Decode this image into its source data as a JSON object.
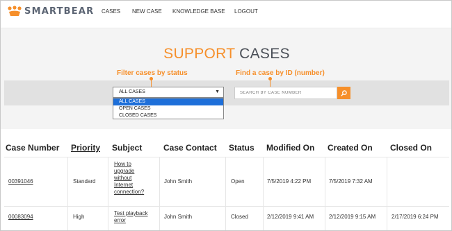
{
  "brand": {
    "name": "SMARTBEAR",
    "logo_icon": "smartbear-paw-logo"
  },
  "nav": {
    "items": [
      "CASES",
      "NEW CASE",
      "KNOWLEDGE BASE",
      "LOGOUT"
    ]
  },
  "page": {
    "title_accent": "SUPPORT",
    "title_rest": "CASES"
  },
  "callouts": {
    "filter": "Filter cases by status",
    "search": "Find a case by ID (number)"
  },
  "filter": {
    "selected": "ALL CASES",
    "options": [
      "ALL CASES",
      "OPEN CASES",
      "CLOSED CASES"
    ]
  },
  "search": {
    "placeholder": "SEARCH BY CASE NUMBER",
    "icon": "search-icon"
  },
  "table": {
    "headers": [
      "Case Number",
      "Priority",
      "Subject",
      "Case Contact",
      "Status",
      "Modified On",
      "Created On",
      "Closed On"
    ],
    "rows": [
      {
        "case_number": "00391046",
        "priority": "Standard",
        "subject_lines": [
          "How to",
          "upgrade",
          "without",
          "Internet",
          "connection?"
        ],
        "contact": "John Smith",
        "status": "Open",
        "modified": "7/5/2019 4:22 PM",
        "created": "7/5/2019 7:32 AM",
        "closed": ""
      },
      {
        "case_number": "00083094",
        "priority": "High",
        "subject_lines": [
          "Test playback",
          "error"
        ],
        "contact": "John Smith",
        "status": "Closed",
        "modified": "2/12/2019 9:41 AM",
        "created": "2/12/2019 9:15 AM",
        "closed": "2/17/2019 6:24 PM"
      }
    ]
  },
  "colors": {
    "accent": "#f68f2a",
    "selected_option": "#1e6fd9"
  }
}
